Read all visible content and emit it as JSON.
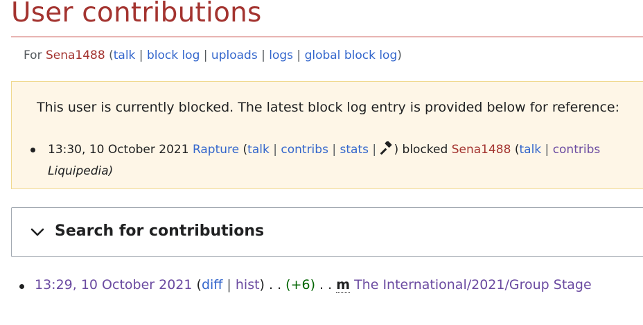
{
  "page": {
    "title": "User contributions"
  },
  "subtitle": {
    "prefix": "For ",
    "username": "Sena1488",
    "open_paren": " (",
    "links": [
      "talk",
      "block log",
      "uploads",
      "logs",
      "global block log"
    ],
    "separator": " | ",
    "close_paren": ")"
  },
  "block_notice": {
    "text": "This user is currently blocked. The latest block log entry is provided below for reference:",
    "entry": {
      "timestamp": "13:30, 10 October 2021",
      "admin": "Rapture",
      "admin_links": [
        "talk",
        "contribs",
        "stats"
      ],
      "action": "blocked",
      "target": "Sena1488",
      "target_links": [
        "talk",
        "contribs"
      ],
      "line2": "Liquipedia)"
    }
  },
  "search": {
    "title": "Search for contributions",
    "expanded": false
  },
  "contributions": [
    {
      "timestamp": "13:29, 10 October 2021",
      "diff": "diff",
      "hist": "hist",
      "dots": " . . ",
      "size": "(+6)",
      "minor": "m",
      "page": "The International/2021/Group Stage"
    }
  ],
  "colors": {
    "title": "#a3332f",
    "link": "#3366cc",
    "visited": "#6b4ba1",
    "redlink": "#a3332f",
    "notice_bg": "#fef6e7",
    "notice_border": "#f0d98f",
    "positive_size": "#006400"
  }
}
